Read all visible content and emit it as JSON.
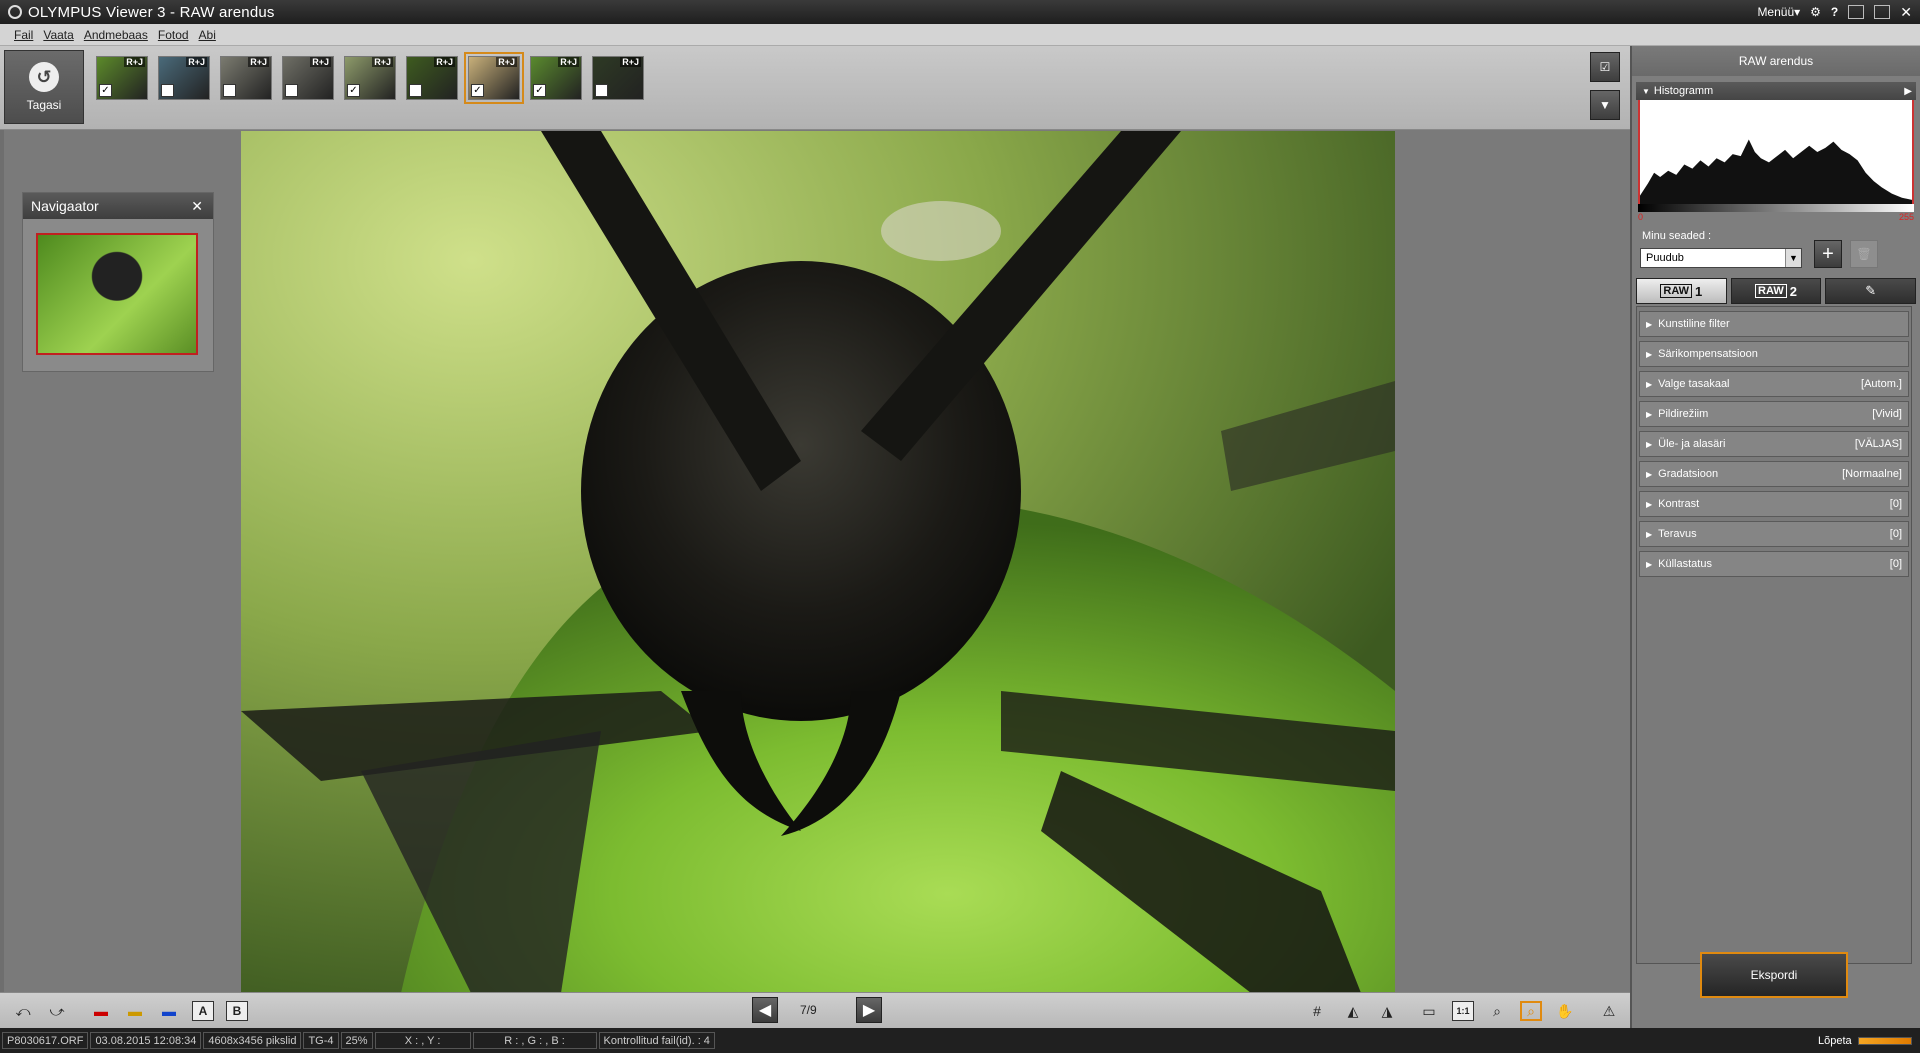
{
  "window": {
    "title": "OLYMPUS Viewer 3 - RAW arendus",
    "menu_label": "Menüü▾"
  },
  "menubar": {
    "items": [
      "Fail",
      "Vaata",
      "Andmebaas",
      "Fotod",
      "Abi"
    ]
  },
  "filmstrip": {
    "back_label": "Tagasi",
    "thumbnails": [
      {
        "badge": "R+J",
        "checked": true,
        "color": "#5c8a2a"
      },
      {
        "badge": "R+J",
        "checked": false,
        "color": "#4a6a7a"
      },
      {
        "badge": "R+J",
        "checked": false,
        "color": "#7b7b70"
      },
      {
        "badge": "R+J",
        "checked": false,
        "color": "#6f6f66"
      },
      {
        "badge": "R+J",
        "checked": true,
        "color": "#8d9a6a"
      },
      {
        "badge": "R+J",
        "checked": false,
        "color": "#3e5b1f"
      },
      {
        "badge": "R+J",
        "checked": true,
        "color": "#c8b07a",
        "selected": true
      },
      {
        "badge": "R+J",
        "checked": true,
        "color": "#5a8a2e"
      },
      {
        "badge": "R+J",
        "checked": false,
        "color": "#2e3a24"
      }
    ]
  },
  "navigator": {
    "title": "Navigaator"
  },
  "bottombar": {
    "counter": "7/9",
    "icons_left": [
      "A",
      "B"
    ]
  },
  "statusbar": {
    "filename": "P8030617.ORF",
    "datetime": "03.08.2015 12:08:34",
    "size": "4608x3456 pikslid",
    "model": "TG-4",
    "zoom": "25%",
    "xy": "X : , Y :",
    "rgb": "R : , G : , B :",
    "checked_files": "Kontrollitud fail(id). : 4",
    "finish": "Lõpeta"
  },
  "rightpanel": {
    "title": "RAW arendus",
    "histogram_label": "Histogramm",
    "hist_min": "0",
    "hist_max": "255",
    "my_settings_label": "Minu seaded :",
    "my_settings_value": "Puudub",
    "tabs": [
      {
        "raw": "RAW",
        "num": "1"
      },
      {
        "raw": "RAW",
        "num": "2"
      }
    ],
    "settings": [
      {
        "label": "Kunstiline filter",
        "value": ""
      },
      {
        "label": "Särikompensatsioon",
        "value": ""
      },
      {
        "label": "Valge tasakaal",
        "value": "[Autom.]"
      },
      {
        "label": "Pildirežiim",
        "value": "[Vivid]"
      },
      {
        "label": "Üle- ja alasäri",
        "value": "[VÄLJAS]"
      },
      {
        "label": "Gradatsioon",
        "value": "[Normaalne]"
      },
      {
        "label": "Kontrast",
        "value": "[0]"
      },
      {
        "label": "Teravus",
        "value": "[0]"
      },
      {
        "label": "Küllastatus",
        "value": "[0]"
      }
    ],
    "export_label": "Ekspordi"
  }
}
